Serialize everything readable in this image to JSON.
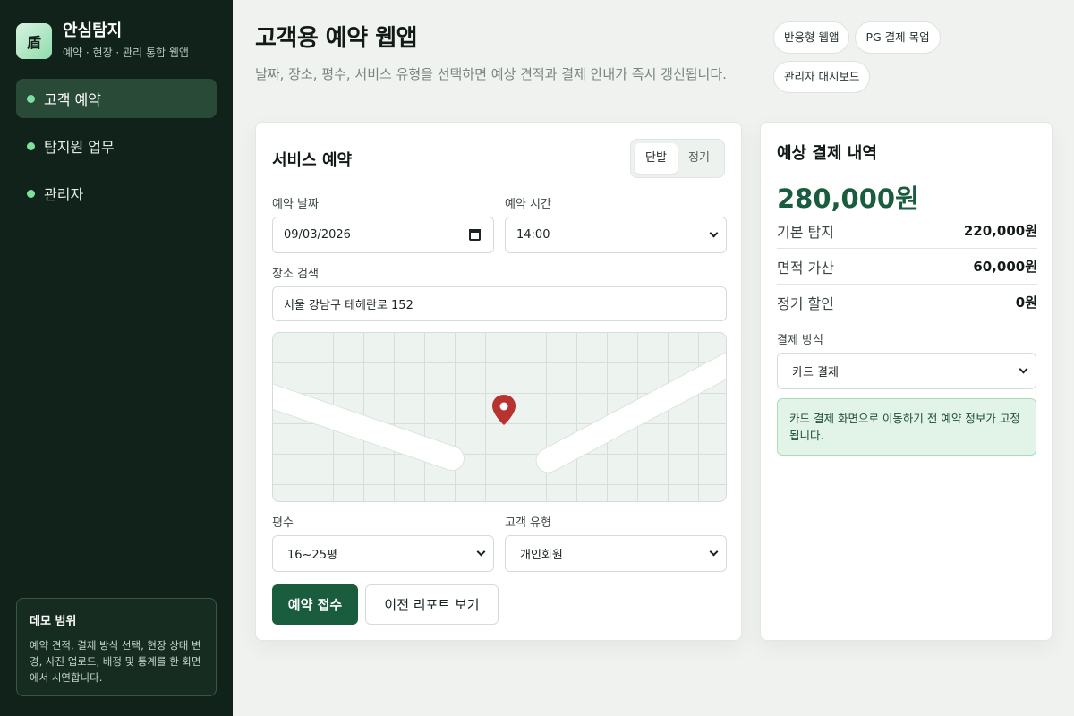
{
  "brand": {
    "logo": "盾",
    "name": "안심탐지",
    "subtitle": "예약 · 현장 · 관리 통합 웹앱"
  },
  "sidebar": {
    "items": [
      {
        "label": "고객 예약",
        "active": true
      },
      {
        "label": "탐지원 업무",
        "active": false
      },
      {
        "label": "관리자",
        "active": false
      }
    ],
    "demo": {
      "title": "데모 범위",
      "text": "예약 견적, 결제 방식 선택, 현장 상태 변경, 사진 업로드, 배정 및 통계를 한 화면에서 시연합니다."
    }
  },
  "header": {
    "title": "고객용 예약 웹앱",
    "subtitle": "날짜, 장소, 평수, 서비스 유형을 선택하면 예상 견적과 결제 안내가 즉시 갱신됩니다.",
    "badges": [
      "반응형 웹앱",
      "PG 결제 목업",
      "관리자 대시보드"
    ]
  },
  "booking": {
    "title": "서비스 예약",
    "segments": [
      {
        "label": "단발",
        "active": true
      },
      {
        "label": "정기",
        "active": false
      }
    ],
    "date": {
      "label": "예약 날짜",
      "value": "09/03/2026"
    },
    "time": {
      "label": "예약 시간",
      "value": "14:00"
    },
    "location": {
      "label": "장소 검색",
      "value": "서울 강남구 테헤란로 152"
    },
    "size": {
      "label": "평수",
      "value": "16~25평"
    },
    "customer_type": {
      "label": "고객 유형",
      "value": "개인회원"
    },
    "submit_label": "예약 접수",
    "history_label": "이전 리포트 보기"
  },
  "summary": {
    "title": "예상 결제 내역",
    "total": "280,000원",
    "lines": [
      {
        "label": "기본 탐지",
        "value": "220,000원"
      },
      {
        "label": "면적 가산",
        "value": "60,000원"
      },
      {
        "label": "정기 할인",
        "value": "0원"
      }
    ],
    "payment": {
      "label": "결제 방식",
      "value": "카드 결제"
    },
    "notice": "카드 결제 화면으로 이동하기 전 예약 정보가 고정됩니다."
  },
  "colors": {
    "sidebar_bg": "#10221a",
    "accent": "#195c3e",
    "dot": "#7ee09e",
    "pin": "#b8322f"
  },
  "icons": {
    "map_marker": "map-pin-icon",
    "calendar": "calendar-icon",
    "dropdown": "chevron-down-icon"
  }
}
